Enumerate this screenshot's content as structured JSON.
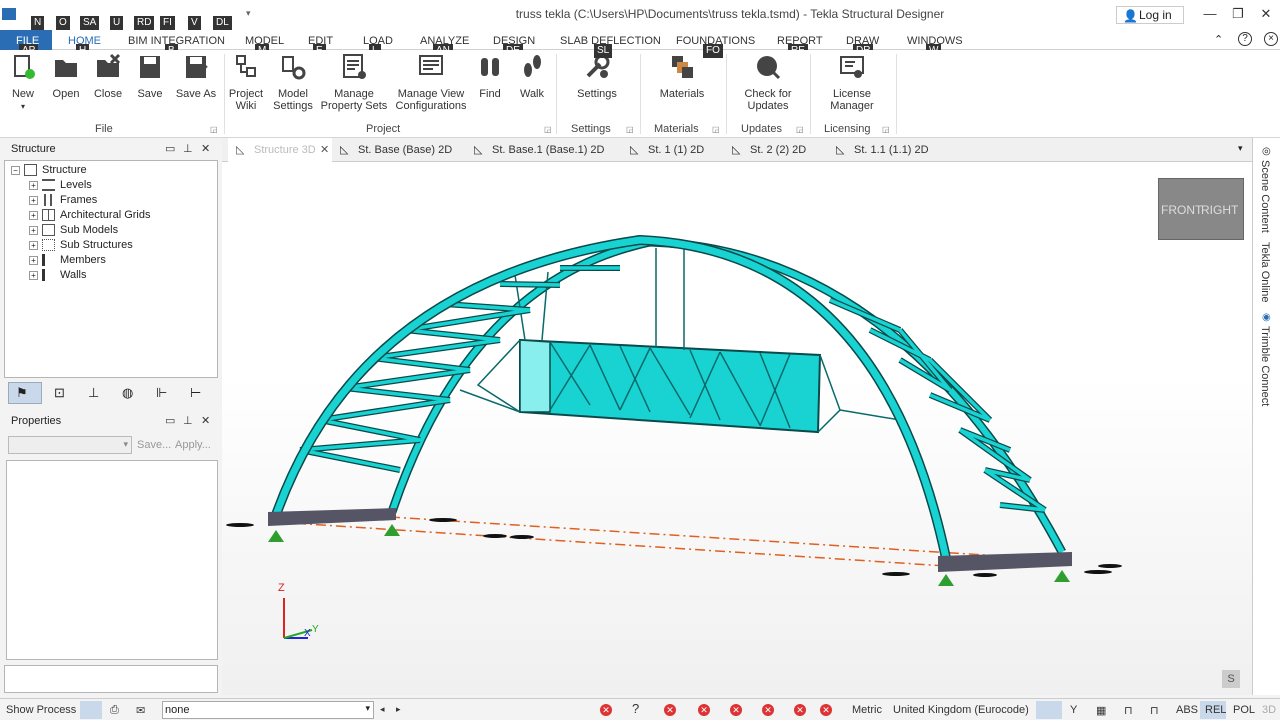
{
  "window": {
    "title": "truss tekla (C:\\Users\\HP\\Documents\\truss tekla.tsmd) - Tekla Structural Designer",
    "login_label": "Log in"
  },
  "quick_access_keys": [
    "N",
    "O",
    "SA",
    "U",
    "RD",
    "FI",
    "V",
    "DL"
  ],
  "menubar": {
    "file": "FILE",
    "items": [
      {
        "label": "HOME",
        "key": "H"
      },
      {
        "label": "BIM INTEGRATION",
        "key": "B"
      },
      {
        "label": "MODEL",
        "key": "M"
      },
      {
        "label": "EDIT",
        "key": "E"
      },
      {
        "label": "LOAD",
        "key": "L"
      },
      {
        "label": "ANALYZE",
        "key": "AN"
      },
      {
        "label": "DESIGN",
        "key": "DE"
      },
      {
        "label": "SLAB DEFLECTION",
        "key": "SL"
      },
      {
        "label": "FOUNDATIONS",
        "key": "FO"
      },
      {
        "label": "REPORT",
        "key": "RE"
      },
      {
        "label": "DRAW",
        "key": "DR"
      },
      {
        "label": "WINDOWS",
        "key": "W"
      }
    ],
    "file_key": "AP"
  },
  "ribbon": {
    "buttons": [
      {
        "l1": "New",
        "l2": ""
      },
      {
        "l1": "Open",
        "l2": ""
      },
      {
        "l1": "Close",
        "l2": ""
      },
      {
        "l1": "Save",
        "l2": ""
      },
      {
        "l1": "Save As",
        "l2": ""
      },
      {
        "l1": "Project",
        "l2": "Wiki"
      },
      {
        "l1": "Model",
        "l2": "Settings"
      },
      {
        "l1": "Manage",
        "l2": "Property Sets"
      },
      {
        "l1": "Manage View",
        "l2": "Configurations"
      },
      {
        "l1": "Find",
        "l2": ""
      },
      {
        "l1": "Walk",
        "l2": ""
      },
      {
        "l1": "Settings",
        "l2": ""
      },
      {
        "l1": "Materials",
        "l2": ""
      },
      {
        "l1": "Check for",
        "l2": "Updates"
      },
      {
        "l1": "License",
        "l2": "Manager"
      }
    ],
    "groups": [
      "File",
      "Project",
      "Settings",
      "Materials",
      "Updates",
      "Licensing"
    ]
  },
  "structure_panel": {
    "title": "Structure",
    "root": "Structure",
    "items": [
      "Levels",
      "Frames",
      "Architectural Grids",
      "Sub Models",
      "Sub Structures",
      "Members",
      "Walls"
    ]
  },
  "properties_panel": {
    "title": "Properties",
    "save_label": "Save...",
    "apply_label": "Apply..."
  },
  "view_tabs": [
    "Structure 3D",
    "St. Base (Base) 2D",
    "St. Base.1 (Base.1) 2D",
    "St. 1 (1) 2D",
    "St. 2 (2) 2D",
    "St. 1.1 (1.1) 2D"
  ],
  "viewcube": {
    "front": "FRONT",
    "right": "RIGHT"
  },
  "axes": {
    "z": "Z",
    "x": "X",
    "y": "Y"
  },
  "viewport_badge": "S",
  "right_bar": [
    "Scene Content",
    "Tekla Online",
    "Trimble Connect"
  ],
  "statusbar": {
    "show_process": "Show Process",
    "input_value": "none",
    "units": "Metric",
    "code": "United Kingdom (Eurocode)",
    "abs": "ABS",
    "rel": "REL",
    "pol": "POL",
    "mode3d": "3D"
  },
  "colors": {
    "truss": "#19d3d3",
    "accent": "#2a6db5",
    "support": "#2e9e2e"
  }
}
